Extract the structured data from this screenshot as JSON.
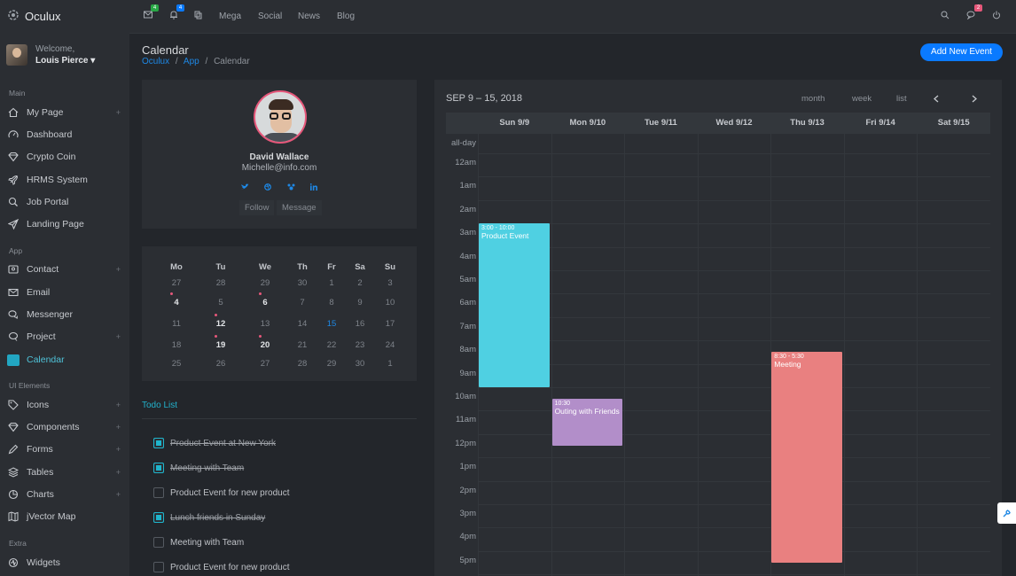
{
  "brand": {
    "name": "Oculux"
  },
  "user": {
    "welcome": "Welcome,",
    "name": "Louis Pierce ▾"
  },
  "nav": {
    "sections": {
      "main": "Main",
      "app": "App",
      "ui": "UI Elements",
      "extra": "Extra"
    },
    "items": [
      {
        "label": "My Page",
        "icon": "home-icon",
        "plus": "+"
      },
      {
        "label": "Dashboard",
        "icon": "speedometer-icon"
      },
      {
        "label": "Crypto Coin",
        "icon": "diamond-icon"
      },
      {
        "label": "HRMS System",
        "icon": "rocket-icon"
      },
      {
        "label": "Job Portal",
        "icon": "briefcase-icon"
      },
      {
        "label": "Landing Page",
        "icon": "paper-plane-icon"
      },
      {
        "label": "Contact",
        "icon": "contact-card-icon",
        "plus": "+"
      },
      {
        "label": "Email",
        "icon": "envelope-icon"
      },
      {
        "label": "Messenger",
        "icon": "chat-bubbles-icon"
      },
      {
        "label": "Project",
        "icon": "project-chat-icon",
        "plus": "+"
      },
      {
        "label": "Calendar",
        "icon": "calendar-icon"
      },
      {
        "label": "Icons",
        "icon": "tag-icon",
        "plus": "+"
      },
      {
        "label": "Components",
        "icon": "diamond-icon",
        "plus": "+"
      },
      {
        "label": "Forms",
        "icon": "pencil-icon",
        "plus": "+"
      },
      {
        "label": "Tables",
        "icon": "layers-icon",
        "plus": "+"
      },
      {
        "label": "Charts",
        "icon": "pie-chart-icon",
        "plus": "+"
      },
      {
        "label": "jVector Map",
        "icon": "map-icon"
      },
      {
        "label": "Widgets",
        "icon": "puzzle-icon"
      }
    ]
  },
  "topbar": {
    "mail_badge": "4",
    "bell_badge": "4",
    "chat_badge": "2",
    "links": [
      "Mega",
      "Social",
      "News",
      "Blog"
    ]
  },
  "page": {
    "title": "Calendar",
    "breadcrumb": [
      "Oculux",
      "App",
      "Calendar"
    ],
    "sep": "/",
    "add_button": "Add New Event"
  },
  "profile": {
    "name": "David Wallace",
    "email": "Michelle@info.com",
    "follow": "Follow",
    "message": "Message"
  },
  "mini_calendar": {
    "weekdays": [
      "Mo",
      "Tu",
      "We",
      "Th",
      "Fr",
      "Sa",
      "Su"
    ],
    "weeks": [
      [
        "27",
        "28",
        "29",
        "30",
        "1",
        "2",
        "3"
      ],
      [
        "4",
        "5",
        "6",
        "7",
        "8",
        "9",
        "10"
      ],
      [
        "11",
        "12",
        "13",
        "14",
        "15",
        "16",
        "17"
      ],
      [
        "18",
        "19",
        "20",
        "21",
        "22",
        "23",
        "24"
      ],
      [
        "25",
        "26",
        "27",
        "28",
        "29",
        "30",
        "1"
      ]
    ],
    "highlighted": [
      "4",
      "6",
      "12",
      "19",
      "20"
    ],
    "today": "15"
  },
  "todo": {
    "title": "Todo List",
    "items": [
      {
        "label": "Product Event at New York",
        "done": true
      },
      {
        "label": "Meeting with Team",
        "done": true
      },
      {
        "label": "Product Event for new product",
        "done": false
      },
      {
        "label": "Lunch friends in Sunday",
        "done": true
      },
      {
        "label": "Meeting with Team",
        "done": false
      },
      {
        "label": "Product Event for new product",
        "done": false
      }
    ]
  },
  "calendar": {
    "range": "SEP 9 – 15, 2018",
    "views": [
      "month",
      "week",
      "list"
    ],
    "prev_icon": "chevron-left-icon",
    "next_icon": "chevron-right-icon",
    "days": [
      "Sun 9/9",
      "Mon 9/10",
      "Tue 9/11",
      "Wed 9/12",
      "Thu 9/13",
      "Fri 9/14",
      "Sat 9/15"
    ],
    "rows": [
      "all-day",
      "12am",
      "1am",
      "2am",
      "3am",
      "4am",
      "5am",
      "6am",
      "7am",
      "8am",
      "9am",
      "10am",
      "11am",
      "12pm",
      "1pm",
      "2pm",
      "3pm",
      "4pm",
      "5pm"
    ],
    "events": [
      {
        "time": "3:00 - 10:00",
        "title": "Product Event",
        "day": 0,
        "start": 3.0,
        "end": 10.0,
        "color": "#4fd0e2"
      },
      {
        "time": "10:30",
        "title": "Outing with Friends",
        "day": 1,
        "start": 10.3,
        "end": 12.3,
        "color": "#b28ec9"
      },
      {
        "time": "8:30 - 5:30",
        "title": "Meeting",
        "day": 4,
        "start": 8.3,
        "end": 17.3,
        "color": "#e98080"
      }
    ]
  },
  "colors": {
    "accent": "#0a7aff",
    "active": "#22a6c2",
    "badge_green": "#28a745",
    "badge_blue": "#0a7aff",
    "badge_pink": "#e6577a"
  }
}
